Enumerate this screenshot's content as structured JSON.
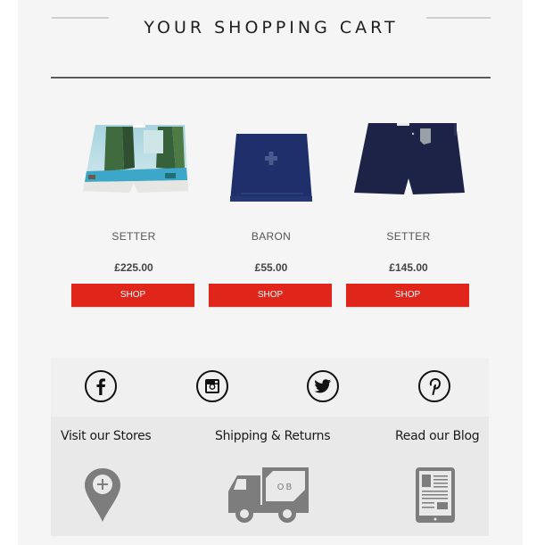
{
  "header": {
    "title": "YOUR SHOPPING CART"
  },
  "products": [
    {
      "name": "SETTER",
      "price": "£225.00",
      "button_label": "SHOP",
      "image": "printed-swim-shorts-image"
    },
    {
      "name": "BARON",
      "price": "£55.00",
      "button_label": "SHOP",
      "image": "navy-towel-image"
    },
    {
      "name": "SETTER",
      "price": "£145.00",
      "button_label": "SHOP",
      "image": "navy-swim-shorts-image"
    }
  ],
  "social": [
    {
      "name": "facebook",
      "icon": "facebook-icon"
    },
    {
      "name": "instagram",
      "icon": "instagram-icon"
    },
    {
      "name": "twitter",
      "icon": "twitter-icon"
    },
    {
      "name": "pinterest",
      "icon": "pinterest-icon"
    }
  ],
  "links": [
    {
      "label": "Visit our Stores",
      "icon": "map-pin-icon"
    },
    {
      "label": "Shipping & Returns",
      "icon": "delivery-truck-icon",
      "truck_text": "OB"
    },
    {
      "label": "Read our Blog",
      "icon": "tablet-article-icon"
    }
  ],
  "colors": {
    "accent": "#e0261b",
    "background": "#f5f5f5",
    "icon_gray": "#7d7d7d"
  }
}
